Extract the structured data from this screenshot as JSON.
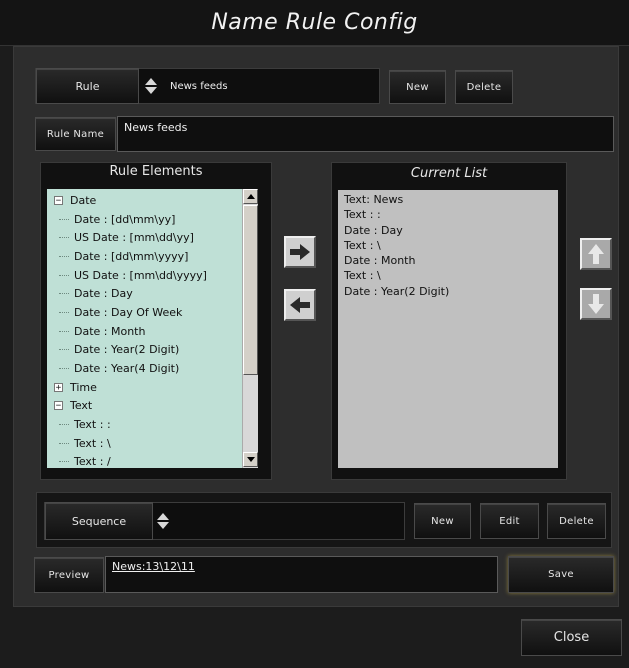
{
  "window": {
    "title": "Name Rule Config"
  },
  "rule": {
    "label": "Rule",
    "selected": "News feeds",
    "new_label": "New",
    "delete_label": "Delete",
    "name_label": "Rule Name",
    "name_value": "News feeds"
  },
  "rule_elements": {
    "title": "Rule Elements",
    "tree": [
      {
        "type": "group",
        "label": "Date",
        "expander": "−"
      },
      {
        "type": "child",
        "label": "Date : [dd\\mm\\yy]"
      },
      {
        "type": "child",
        "label": "US Date : [mm\\dd\\yy]"
      },
      {
        "type": "child",
        "label": "Date : [dd\\mm\\yyyy]"
      },
      {
        "type": "child",
        "label": "US Date : [mm\\dd\\yyyy]"
      },
      {
        "type": "child",
        "label": "Date : Day"
      },
      {
        "type": "child",
        "label": "Date : Day Of Week"
      },
      {
        "type": "child",
        "label": "Date : Month"
      },
      {
        "type": "child",
        "label": "Date : Year(2 Digit)"
      },
      {
        "type": "child",
        "label": "Date : Year(4 Digit)"
      },
      {
        "type": "group",
        "label": "Time",
        "expander": "+"
      },
      {
        "type": "group",
        "label": "Text",
        "expander": "−"
      },
      {
        "type": "child",
        "label": "Text : :"
      },
      {
        "type": "child",
        "label": "Text : \\"
      },
      {
        "type": "child",
        "label": "Text : /"
      }
    ]
  },
  "current_list": {
    "title": "Current List",
    "items": [
      "Text: News",
      "Text : :",
      "Date : Day",
      "Text : \\",
      "Date : Month",
      "Text : \\",
      "Date : Year(2 Digit)"
    ]
  },
  "transfer": {
    "add_icon": "arrow-right-icon",
    "remove_icon": "arrow-left-icon"
  },
  "reorder": {
    "up_icon": "arrow-up-icon",
    "down_icon": "arrow-down-icon"
  },
  "sequence": {
    "label": "Sequence",
    "selected": "",
    "new_label": "New",
    "edit_label": "Edit",
    "delete_label": "Delete"
  },
  "preview": {
    "label": "Preview",
    "value": "News:13\\12\\11",
    "save_label": "Save"
  },
  "footer": {
    "close_label": "Close"
  },
  "colors": {
    "tree_background": "#bfe0d6",
    "list_background": "#c0c0c0",
    "window_background": "#1c1c1c",
    "panel_background": "#2d2d2d"
  }
}
